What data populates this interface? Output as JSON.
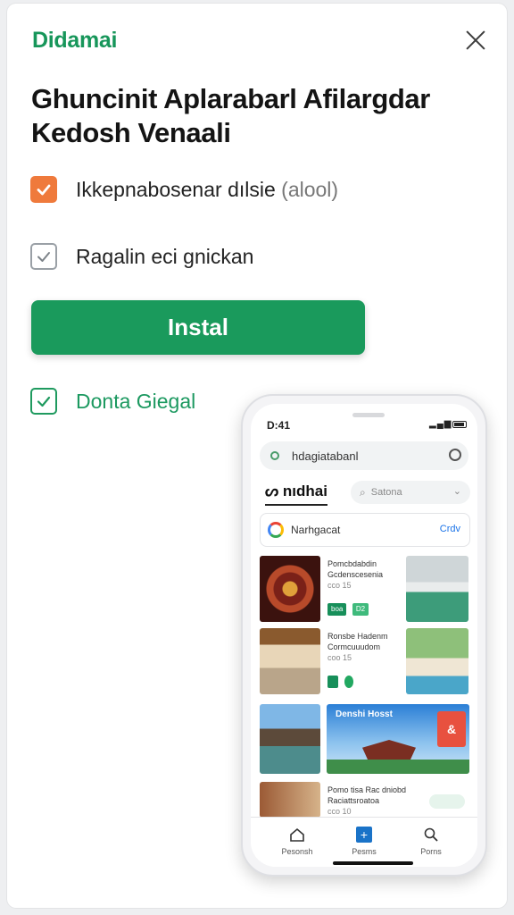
{
  "brand": "Didamai",
  "headline": [
    "Ghuncinit Aplarabarl Afilargdar",
    "Kedosh Venaali"
  ],
  "options": [
    {
      "label": "Ikkepnabosenar dılsie",
      "sub": "(alool)",
      "checked": true,
      "style": "orange"
    },
    {
      "label": "Ragalin eci gnickan",
      "checked": true,
      "style": "grey"
    }
  ],
  "install_label": "Instal",
  "extra_option": {
    "label": "Donta Giegal",
    "checked": true
  },
  "accent_color": "#1a9a5c",
  "phone": {
    "status_time": "D:41",
    "url": "hdagiatabanl",
    "app_name": "nıdhai",
    "search_placeholder": "Satona",
    "google_card": {
      "text": "Narhgacat",
      "cta": "Crdv"
    },
    "rows": [
      {
        "title": "Pomcbdabdin Gcdenscesenia",
        "meta": "cco 15",
        "tags": [
          "boa",
          "D2"
        ]
      },
      {
        "title": "Ronsbe Hadenm Cormcuuudom",
        "meta": "coo 15"
      },
      {
        "banner_title": "Denshi Hosst",
        "badge": "&"
      },
      {
        "title": "Pomo tisa Rac dniobd Raciattsroatoa",
        "meta": "cco 10"
      }
    ],
    "tabs": [
      {
        "label": "Pesonsh",
        "icon": "home-icon"
      },
      {
        "label": "Pesms",
        "icon": "add-square-icon"
      },
      {
        "label": "Porns",
        "icon": "search-icon"
      }
    ]
  }
}
